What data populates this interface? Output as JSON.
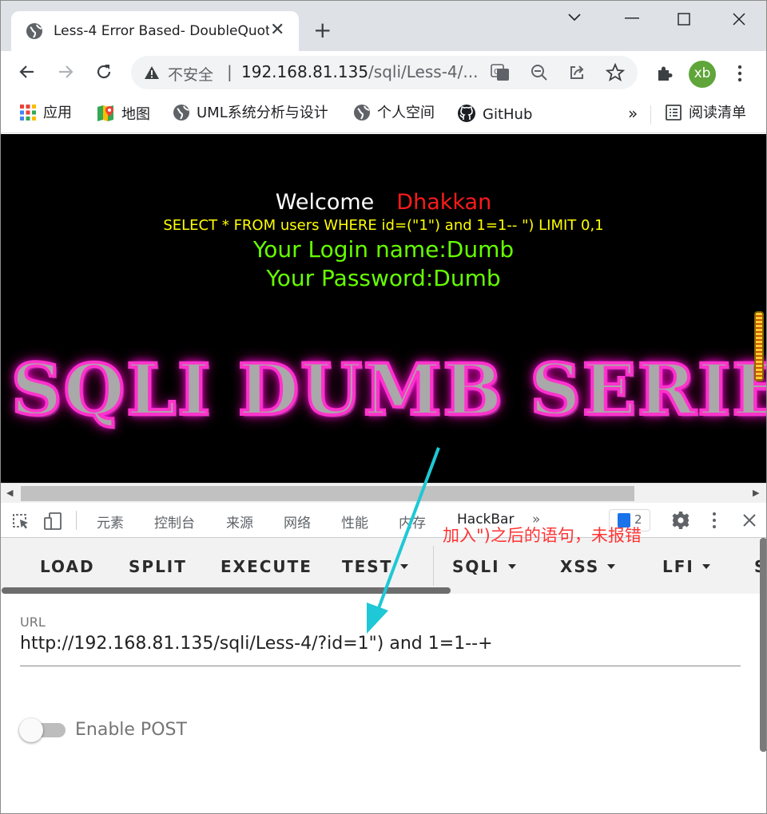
{
  "tab": {
    "title": "Less-4 Error Based- DoubleQuotes",
    "close": "✕",
    "new_tab": "+"
  },
  "window": {
    "minimize": "—",
    "maximize": "☐",
    "close": "✕"
  },
  "omnibox": {
    "security_label": "不安全",
    "separator": "|",
    "url_host": "192.168.81.135",
    "url_path": "/sqli/Less-4/..."
  },
  "profile": {
    "initials": "xb"
  },
  "bookmarks": {
    "items": [
      "应用",
      "地图",
      "UML系统分析与设计",
      "个人空间",
      "GitHub"
    ],
    "overflow": "»",
    "reading_list": "阅读清单"
  },
  "page": {
    "welcome": "Welcome",
    "user": "Dhakkan",
    "query": "SELECT * FROM users WHERE id=(\"1\") and 1=1-- \") LIMIT 0,1",
    "login_name": "Your Login name:Dumb",
    "password": "Your Password:Dumb",
    "banner": "SQLI DUMB SERIES"
  },
  "devtools": {
    "tabs": [
      "元素",
      "控制台",
      "来源",
      "网络",
      "性能",
      "内存",
      "HackBar"
    ],
    "more": "»",
    "issues_count": "2"
  },
  "hackbar": {
    "menu": [
      "LOAD",
      "SPLIT",
      "EXECUTE",
      "TEST",
      "SQLI",
      "XSS",
      "LFI",
      "S"
    ],
    "url_label": "URL",
    "url_value": "http://192.168.81.135/sqli/Less-4/?id=1\") and 1=1--+",
    "enable_post": "Enable POST"
  },
  "annotation": "加入\")之后的语句，未报错",
  "colors": {
    "annotation": "#ff3333",
    "arrow": "#1ec8d6",
    "login_text": "#66ff00",
    "query_text": "#ffff00",
    "user_name": "#ff1a1a"
  }
}
